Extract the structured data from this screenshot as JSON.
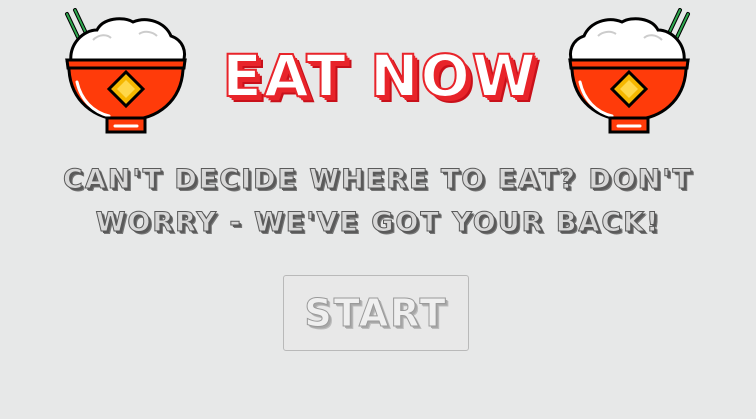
{
  "header": {
    "title": "EAT NOW",
    "left_icon": "rice-bowl-icon",
    "right_icon": "rice-bowl-icon"
  },
  "tagline": "CAN'T DECIDE WHERE TO EAT? DON'T WORRY - WE'VE GOT YOUR BACK!",
  "start_button": {
    "label": "START"
  },
  "colors": {
    "background": "#e7e8e8",
    "title_red": "#e8242a",
    "bowl_red": "#ff3b0a",
    "bowl_gold": "#f5b700",
    "chopstick_green": "#2fa84f",
    "text_gray": "#5a5a5a"
  }
}
